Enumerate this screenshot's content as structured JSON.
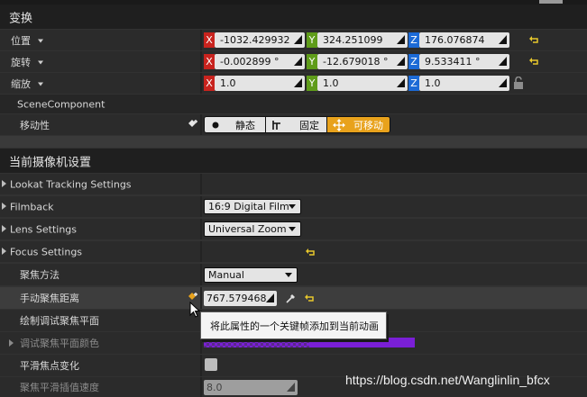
{
  "transform": {
    "title": "变换",
    "location": {
      "label": "位置",
      "x": "-1032.429932",
      "y": "324.251099",
      "z": "176.076874"
    },
    "rotation": {
      "label": "旋转",
      "x": "-0.002899 °",
      "y": "-12.679018 °",
      "z": "9.533411 °"
    },
    "scale": {
      "label": "缩放",
      "x": "1.0",
      "y": "1.0",
      "z": "1.0"
    },
    "axis": {
      "x": "X",
      "y": "Y",
      "z": "Z"
    }
  },
  "scene_component": {
    "title": "SceneComponent",
    "mobility_label": "移动性",
    "mobility": {
      "static": "静态",
      "stationary": "固定",
      "movable": "可移动",
      "active": "movable"
    }
  },
  "camera": {
    "title": "当前摄像机设置",
    "lookat": "Lookat Tracking Settings",
    "filmback": {
      "label": "Filmback",
      "value": "16:9 Digital Film"
    },
    "lens": {
      "label": "Lens Settings",
      "value": "Universal Zoom"
    },
    "focus": {
      "label": "Focus Settings",
      "method": {
        "label": "聚焦方法",
        "value": "Manual"
      },
      "manual_distance": {
        "label": "手动聚焦距离",
        "value": "767.579468"
      },
      "draw_debug_plane": {
        "label": "绘制调试聚焦平面"
      },
      "debug_plane_color": {
        "label": "调试聚焦平面颜色",
        "color": "#7a1fd6"
      },
      "smooth_focus": {
        "label": "平滑焦点变化"
      },
      "smooth_speed": {
        "label": "聚焦平滑插值速度",
        "value": "8.0"
      }
    },
    "tooltip": "将此属性的一个关键帧添加到当前动画"
  },
  "watermark": "https://blog.csdn.net/Wanglinlin_bfcx",
  "colors": {
    "accent": "#e8a21c",
    "panel": "#323232",
    "section": "#1f1f1f",
    "key_icon": "#e8a21c"
  }
}
